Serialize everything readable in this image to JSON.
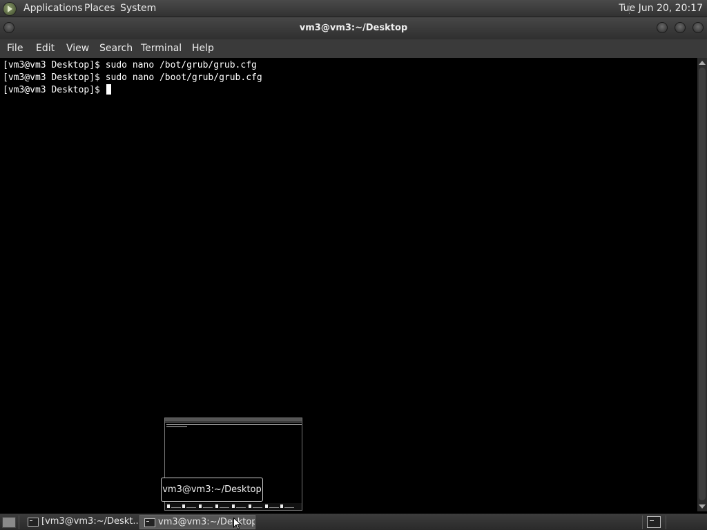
{
  "top_panel": {
    "menus": [
      "Applications",
      "Places",
      "System"
    ],
    "clock": "Tue Jun 20, 20:17"
  },
  "window": {
    "title": "vm3@vm3:~/Desktop"
  },
  "menubar": {
    "items": [
      "File",
      "Edit",
      "View",
      "Search",
      "Terminal",
      "Help"
    ]
  },
  "terminal": {
    "lines": [
      "[vm3@vm3 Desktop]$ sudo nano /bot/grub/grub.cfg",
      "[vm3@vm3 Desktop]$ sudo nano /boot/grub/grub.cfg",
      "[vm3@vm3 Desktop]$ "
    ]
  },
  "tooltip": {
    "text": "vm3@vm3:~/Desktop"
  },
  "taskbar": {
    "tasks": [
      {
        "label": "[vm3@vm3:~/Deskt...",
        "active": false
      },
      {
        "label": "vm3@vm3:~/Desktop",
        "active": true
      }
    ]
  },
  "icons": {
    "app_logo": "applications-menu-icon",
    "show_desktop": "show-desktop-icon",
    "terminal": "terminal-icon",
    "pointer": "mouse-pointer-icon"
  },
  "colors": {
    "panel": "#3a3a3a",
    "terminal_bg": "#000000",
    "terminal_fg": "#ffffff"
  }
}
